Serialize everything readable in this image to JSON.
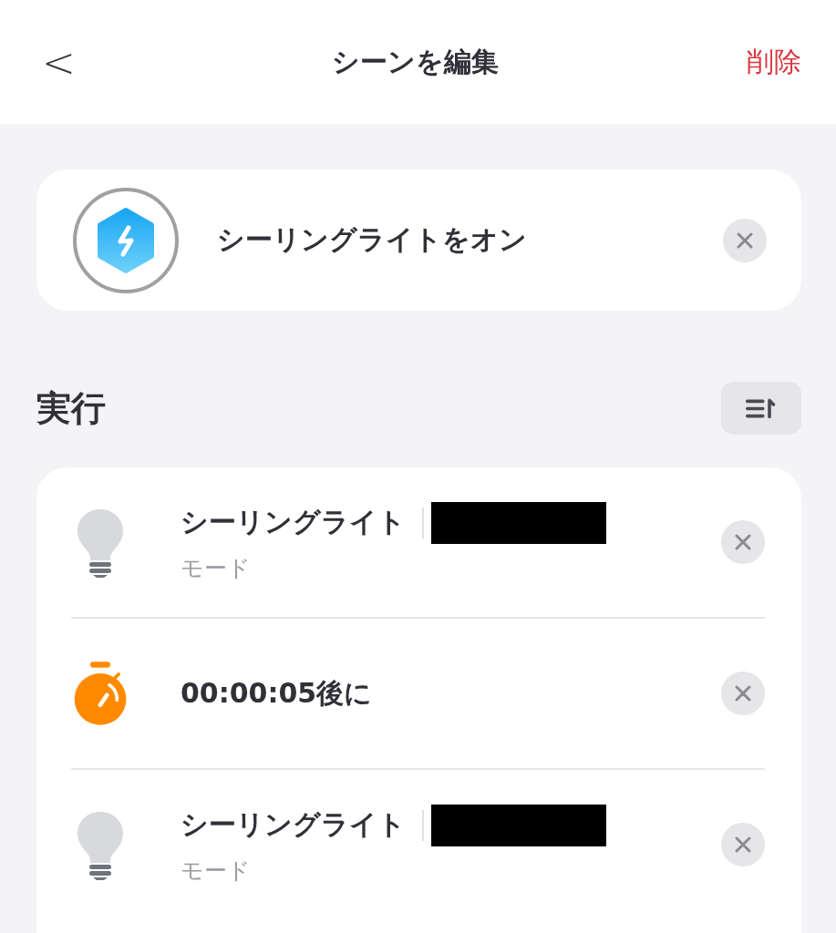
{
  "header": {
    "back": "<",
    "title": "シーンを編集",
    "delete": "削除"
  },
  "scene": {
    "name": "シーリングライトをオン"
  },
  "section": {
    "title": "実行"
  },
  "actions": [
    {
      "kind": "device",
      "title": "シーリングライト",
      "subtitle": "モード",
      "redacted": true
    },
    {
      "kind": "delay",
      "title": "00:00:05後に"
    },
    {
      "kind": "device",
      "title": "シーリングライト",
      "subtitle": "モード",
      "redacted": true
    }
  ]
}
